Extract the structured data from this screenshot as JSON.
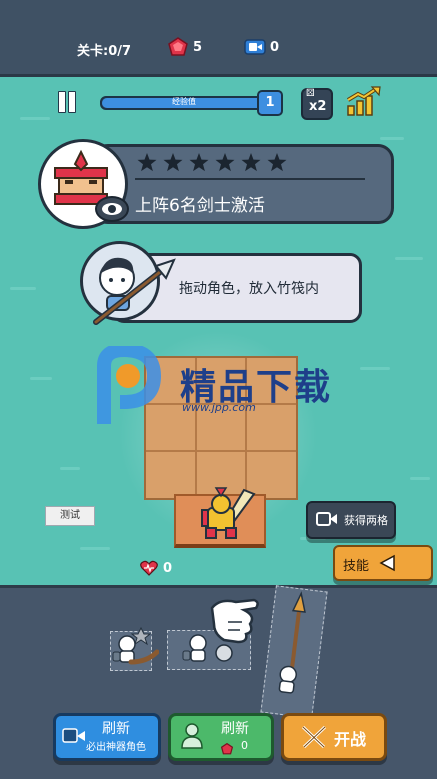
{
  "topbar": {
    "level_label": "关卡:0/7",
    "gems": "5",
    "tickets": "0"
  },
  "hud": {
    "xp_label": "经验值",
    "level": "1",
    "speed": "x2"
  },
  "quest": {
    "stars": 6,
    "text": "上阵6名剑士激活"
  },
  "tutorial": {
    "text": "拖动角色，放入竹筏内"
  },
  "watermark": {
    "title": "精品下载",
    "url": "www.jpp.com"
  },
  "side": {
    "test_label": "测试",
    "get_two_label": "获得两格",
    "skill_label": "技能"
  },
  "lives": "0",
  "buttons": {
    "refresh_ad_title": "刷新",
    "refresh_ad_sub": "必出神器角色",
    "refresh_title": "刷新",
    "refresh_cost": "0",
    "battle_label": "开战"
  },
  "colors": {
    "water": "#58c2b4",
    "topbar": "#3f5164",
    "xp_bar": "#3d8fe0",
    "blue_button": "#2f8ee0",
    "green_button": "#4cb96a",
    "orange_button": "#f0a43a",
    "raft": "#d9a06a"
  }
}
